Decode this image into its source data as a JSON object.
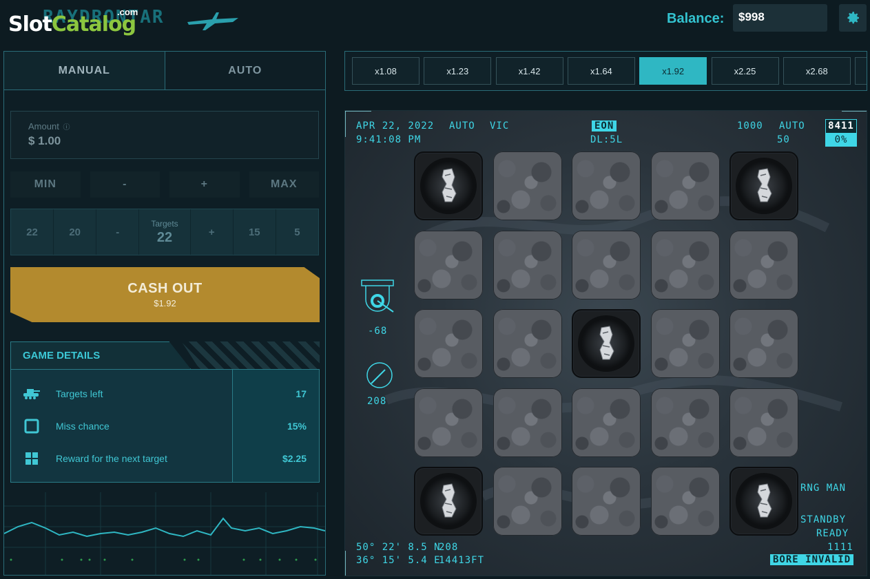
{
  "header": {
    "watermark_slot": "Slot",
    "watermark_catalog": "Catalog",
    "watermark_com": ".com",
    "game_title": "RAYDRONTAR",
    "balance_label": "Balance:",
    "balance_value": "$998",
    "settings_icon": "gear-icon"
  },
  "tabs": [
    {
      "label": "MANUAL",
      "active": true
    },
    {
      "label": "AUTO",
      "active": false
    }
  ],
  "amount": {
    "label": "Amount",
    "info_icon": "info-icon",
    "value": "$ 1.00"
  },
  "amount_buttons": [
    "MIN",
    "-",
    "+",
    "MAX"
  ],
  "targets": {
    "left_values": [
      "22",
      "20",
      "-"
    ],
    "label": "Targets",
    "value": "22",
    "right_values": [
      "+",
      "15",
      "5"
    ]
  },
  "cashout": {
    "label": "CASH OUT",
    "amount": "$1.92"
  },
  "game_details": {
    "title": "GAME DETAILS",
    "rows": [
      {
        "icon": "tank-icon",
        "label": "Targets left",
        "value": "17"
      },
      {
        "icon": "square-icon",
        "label": "Miss chance",
        "value": "15%"
      },
      {
        "icon": "grid-icon",
        "label": "Reward for the next target",
        "value": "$2.25"
      }
    ]
  },
  "multipliers": {
    "items": [
      "x1.08",
      "x1.23",
      "x1.42",
      "x1.64",
      "x1.92",
      "x2.25",
      "x2.68"
    ],
    "active_index": 4
  },
  "hud": {
    "date": "APR 22, 2022",
    "time": "9:41:08 PM",
    "mode": "AUTO",
    "vic": "VIC",
    "eon": "EON",
    "dl": "DL:5L",
    "top_right_a": "1000",
    "top_right_b": "AUTO",
    "top_right_c": "50",
    "counter": "8411",
    "counter_pct": "0%",
    "gauge1_value": "-68",
    "gauge2_value": "208",
    "rng": "RNG MAN",
    "standby": "STANDBY",
    "ready": "READY",
    "code": "1111",
    "bore": "BORE INVALID",
    "lat": "50° 22' 8.5 N",
    "lat_val": "208",
    "lon": "36° 15' 5.4 E",
    "alt": "14413FT"
  },
  "board": {
    "rows": 5,
    "cols": 5,
    "hit_cells": [
      [
        0,
        0
      ],
      [
        0,
        4
      ],
      [
        2,
        2
      ],
      [
        4,
        0
      ],
      [
        4,
        4
      ]
    ]
  }
}
